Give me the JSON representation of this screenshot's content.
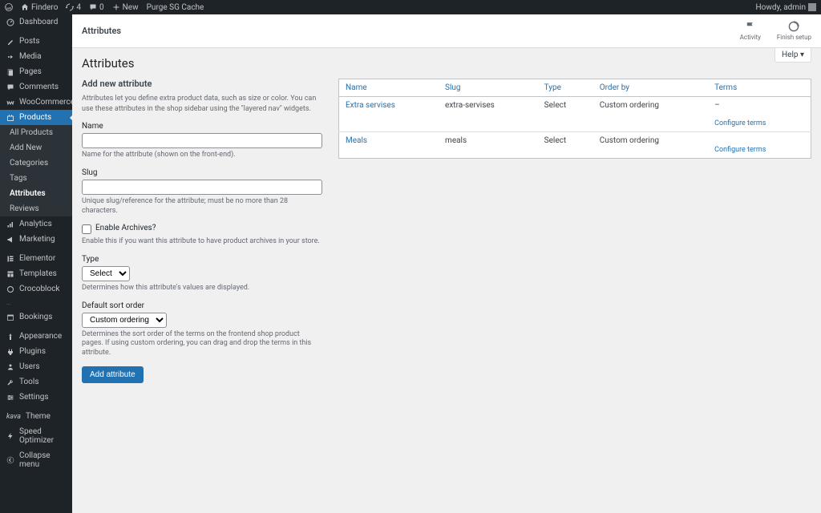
{
  "adminbar": {
    "site_name": "Findero",
    "updates": "4",
    "comments": "0",
    "new": "New",
    "purge": "Purge SG Cache",
    "howdy": "Howdy, admin"
  },
  "sidemenu": {
    "dashboard": "Dashboard",
    "posts": "Posts",
    "media": "Media",
    "pages": "Pages",
    "comments": "Comments",
    "woocommerce": "WooCommerce",
    "products": "Products",
    "products_sub": {
      "all": "All Products",
      "add": "Add New",
      "categories": "Categories",
      "tags": "Tags",
      "attributes": "Attributes",
      "reviews": "Reviews"
    },
    "analytics": "Analytics",
    "marketing": "Marketing",
    "elementor": "Elementor",
    "templates": "Templates",
    "crocoblock": "Crocoblock",
    "rooms": "...",
    "bookings": "Bookings",
    "appearance": "Appearance",
    "plugins": "Plugins",
    "users": "Users",
    "tools": "Tools",
    "settings": "Settings",
    "theme": "Theme",
    "speed": "Speed Optimizer",
    "collapse": "Collapse menu"
  },
  "pagehead": {
    "title": "Attributes",
    "activity": "Activity",
    "finish": "Finish setup"
  },
  "help": "Help",
  "h1": "Attributes",
  "form": {
    "add_title": "Add new attribute",
    "intro": "Attributes let you define extra product data, such as size or color. You can use these attributes in the shop sidebar using the \"layered nav\" widgets.",
    "name_label": "Name",
    "name_help": "Name for the attribute (shown on the front-end).",
    "slug_label": "Slug",
    "slug_help": "Unique slug/reference for the attribute; must be no more than 28 characters.",
    "archives_label": "Enable Archives?",
    "archives_help": "Enable this if you want this attribute to have product archives in your store.",
    "type_label": "Type",
    "type_opt": "Select",
    "type_help": "Determines how this attribute's values are displayed.",
    "sort_label": "Default sort order",
    "sort_opt": "Custom ordering",
    "sort_help": "Determines the sort order of the terms on the frontend shop product pages. If using custom ordering, you can drag and drop the terms in this attribute.",
    "submit": "Add attribute"
  },
  "table": {
    "cols": {
      "name": "Name",
      "slug": "Slug",
      "type": "Type",
      "order": "Order by",
      "terms": "Terms"
    },
    "rows": [
      {
        "name": "Extra servises",
        "slug": "extra-servises",
        "type": "Select",
        "order": "Custom ordering",
        "terms": "–",
        "cfg": "Configure terms"
      },
      {
        "name": "Meals",
        "slug": "meals",
        "type": "Select",
        "order": "Custom ordering",
        "terms": "",
        "cfg": "Configure terms"
      }
    ]
  }
}
